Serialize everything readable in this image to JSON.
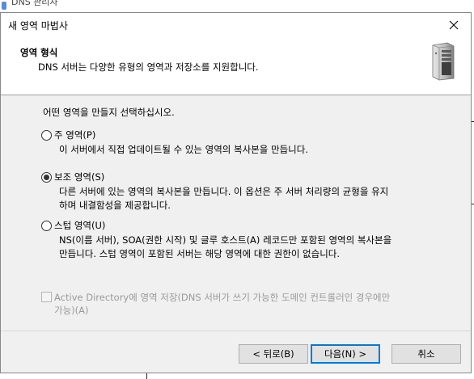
{
  "background_app": {
    "title": "DNS 관리자"
  },
  "dialog": {
    "title": "새 영역 마법사",
    "header": {
      "title": "영역 형식",
      "subtitle": "DNS 서버는 다양한 유형의 영역과 저장소를 지원합니다."
    },
    "prompt": "어떤 영역을 만들지 선택하십시오.",
    "options": [
      {
        "label": "주 영역(P)",
        "checked": false,
        "description": [
          "이 서버에서 직접 업데이트될 수 있는 영역의 복사본을 만듭니다."
        ]
      },
      {
        "label": "보조 영역(S)",
        "checked": true,
        "description": [
          "다른 서버에 있는 영역의 복사본을 만듭니다. 이 옵션은 주 서버 처리량의 균형을 유지",
          "하며 내결함성을 제공합니다."
        ]
      },
      {
        "label": "스텁 영역(U)",
        "checked": false,
        "description": [
          "NS(이름 서버), SOA(권한 시작) 및 글루 호스트(A) 레코드만 포함된 영역의 복사본을",
          "만듭니다. 스텁 영역이 포함된 서버는 해당 영역에 대한 권한이 없습니다."
        ]
      }
    ],
    "ad_checkbox": {
      "label_line1": "Active Directory에 영역 저장(DNS 서버가 쓰기 가능한 도메인 컨트롤러인 경우에만",
      "label_line2": "가능)(A)",
      "checked": false,
      "enabled": false
    },
    "buttons": {
      "back": "< 뒤로(B)",
      "next": "다음(N) >",
      "cancel": "취소"
    }
  },
  "colors": {
    "dialog_bg": "#f0f0f0",
    "header_bg": "#ffffff",
    "default_button_border": "#0078d7",
    "disabled_text": "#9a9a9a"
  },
  "icons": [
    "close-icon",
    "server-icon"
  ]
}
